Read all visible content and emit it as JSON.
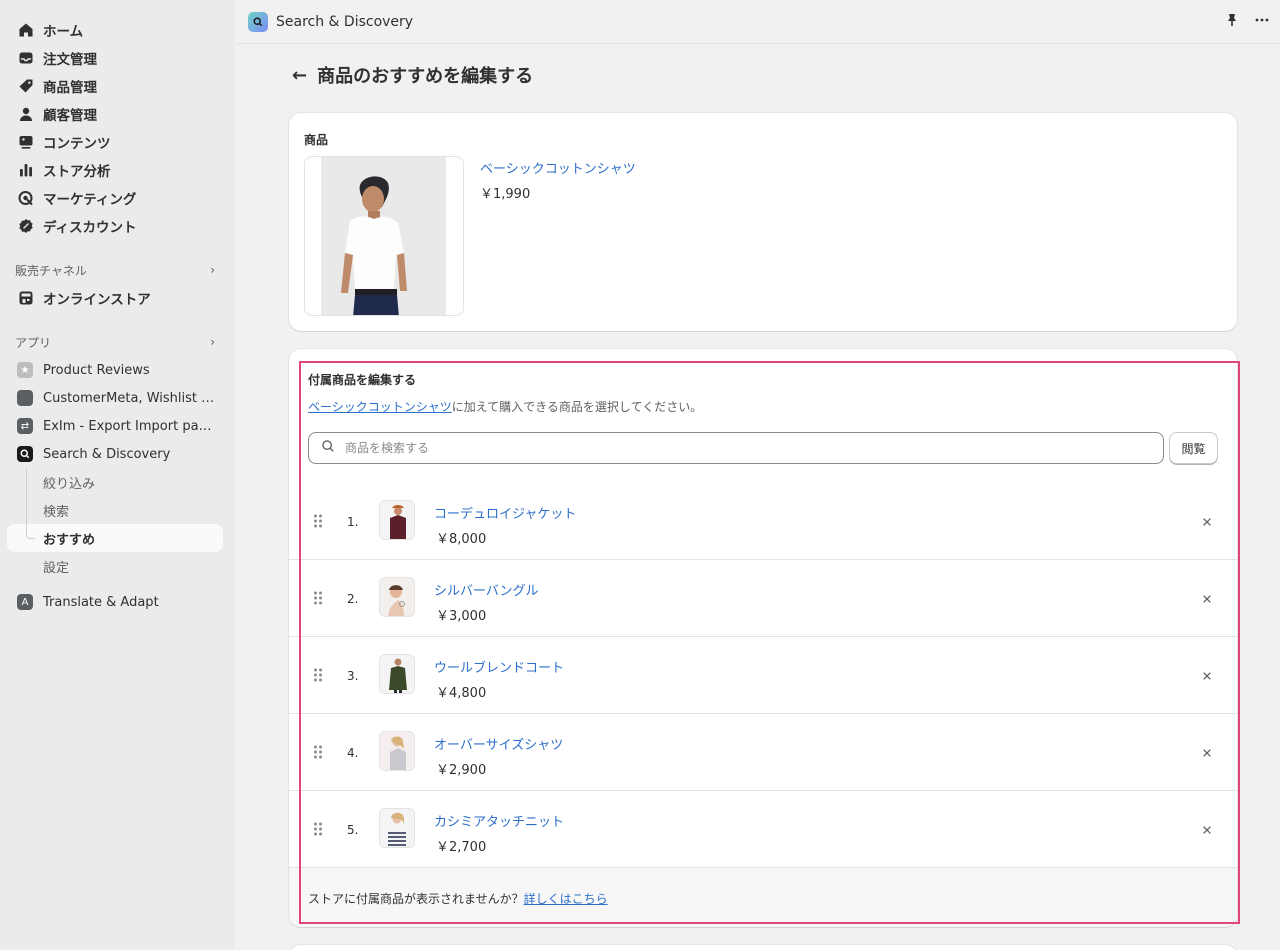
{
  "sidebar": {
    "nav": [
      {
        "label": "ホーム",
        "icon": "home-icon"
      },
      {
        "label": "注文管理",
        "icon": "inbox-icon"
      },
      {
        "label": "商品管理",
        "icon": "tag-icon"
      },
      {
        "label": "顧客管理",
        "icon": "person-icon"
      },
      {
        "label": "コンテンツ",
        "icon": "image-icon"
      },
      {
        "label": "ストア分析",
        "icon": "bar-chart-icon"
      },
      {
        "label": "マーケティング",
        "icon": "target-icon"
      },
      {
        "label": "ディスカウント",
        "icon": "discount-icon"
      }
    ],
    "sales_channels_label": "販売チャネル",
    "online_store_label": "オンラインストア",
    "apps_label": "アプリ",
    "apps": [
      {
        "label": "Product Reviews"
      },
      {
        "label": "CustomerMeta, Wishlist C..."
      },
      {
        "label": "ExIm - Export Import pages"
      },
      {
        "label": "Search & Discovery"
      }
    ],
    "sub_items": [
      {
        "label": "絞り込み"
      },
      {
        "label": "検索"
      },
      {
        "label": "おすすめ"
      },
      {
        "label": "設定"
      }
    ],
    "translate_label": "Translate & Adapt"
  },
  "topbar": {
    "title": "Search & Discovery"
  },
  "page": {
    "title": "商品のおすすめを編集する"
  },
  "product_card": {
    "label": "商品",
    "name": "ベーシックコットンシャツ",
    "price": "￥1,990"
  },
  "related_card": {
    "title": "付属商品を編集する",
    "desc_link": "ベーシックコットンシャツ",
    "desc_rest": "に加えて購入できる商品を選択してください。",
    "search_placeholder": "商品を検索する",
    "browse_label": "閲覧",
    "items": [
      {
        "num": "1.",
        "name": "コーデュロイジャケット",
        "price": "￥8,000"
      },
      {
        "num": "2.",
        "name": "シルバーバングル",
        "price": "￥3,000"
      },
      {
        "num": "3.",
        "name": "ウールブレンドコート",
        "price": "￥4,800"
      },
      {
        "num": "4.",
        "name": "オーバーサイズシャツ",
        "price": "￥2,900"
      },
      {
        "num": "5.",
        "name": "カシミアタッチニット",
        "price": "￥2,700"
      }
    ],
    "footer_text": "ストアに付属商品が表示されませんか？",
    "footer_link": "詳しくはこちら"
  },
  "colors": {
    "link": "#2c6ecb",
    "highlight": "#e0457b",
    "sidebar_bg": "#ebebeb"
  }
}
